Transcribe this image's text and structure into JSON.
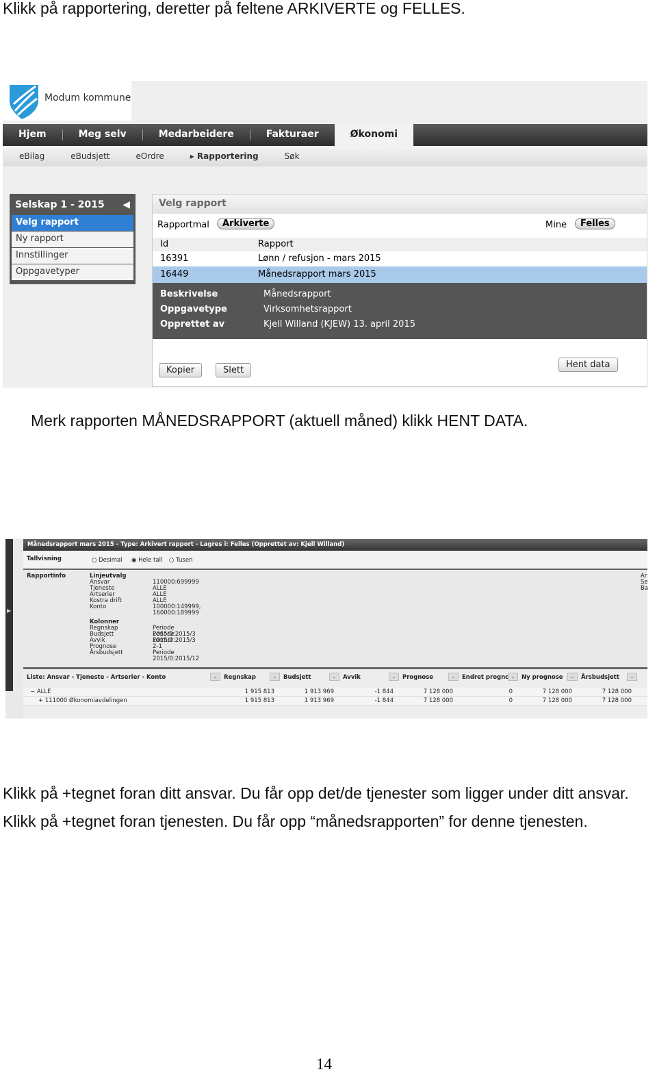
{
  "text": {
    "intro": "Klikk på rapportering, deretter på feltene ARKIVERTE og FELLES.",
    "step2": "Merk rapporten  MÅNEDSRAPPORT (aktuell måned) klikk HENT DATA.",
    "step3": "Klikk på +tegnet foran ditt ansvar. Du får opp det/de tjenester som ligger under ditt ansvar. Klikk på +tegnet foran tjenesten. Du får opp “månedsrapporten” for denne tjenesten.",
    "page_number": "14"
  },
  "shot1": {
    "logo_text": "Modum kommune",
    "brand_color": "#2a9ad8",
    "nav": [
      "Hjem",
      "Meg selv",
      "Medarbeidere",
      "Fakturaer",
      "Økonomi"
    ],
    "nav_active": "Økonomi",
    "subnav": [
      "eBilag",
      "eBudsjett",
      "eOrdre",
      "Rapportering",
      "Søk"
    ],
    "sidebar": {
      "title": "Selskap 1 - 2015",
      "items": [
        "Velg rapport",
        "Ny rapport",
        "Innstillinger",
        "Oppgavetyper"
      ]
    },
    "panel": {
      "title": "Velg rapport",
      "rapportmal_label": "Rapportmal",
      "rapportmal_value": "Arkiverte",
      "mine_label": "Mine",
      "mine_value": "Felles",
      "columns": [
        "Id",
        "Rapport"
      ],
      "rows": [
        [
          "16391",
          "Lønn / refusjon - mars 2015"
        ],
        [
          "16449",
          "Månedsrapport mars 2015"
        ]
      ],
      "details": [
        [
          "Beskrivelse",
          "Månedsrapport"
        ],
        [
          "Oppgavetype",
          "Virksomhetsrapport"
        ],
        [
          "Opprettet av",
          "Kjell Willand (KJEW) 13. april 2015"
        ]
      ],
      "buttons": {
        "kopier": "Kopier",
        "slett": "Slett",
        "hent": "Hent data"
      }
    }
  },
  "shot2": {
    "title": "Månedsrapport mars 2015 - Type: Arkivert rapport - Lagres i: Felles (Opprettet av: Kjell Willand)",
    "tallvisning": "Tallvisning",
    "radios": [
      "Desimal",
      "Hele tall",
      "Tusen"
    ],
    "radio_selected": "Hele tall",
    "rapportinfo": "Rapportinfo",
    "linjeutvalg": "Linjeutvalg",
    "lines": [
      [
        "Ansvar",
        "110000:699999"
      ],
      [
        "Tjeneste",
        "ALLE"
      ],
      [
        "Artserier",
        "ALLE"
      ],
      [
        "Kostra drift",
        "ALLE"
      ],
      [
        "Konto",
        "100000:149999, 160000:189999"
      ]
    ],
    "kolonner": "Kolonner",
    "cols": [
      [
        "Regnskap",
        "Periode 2015/0:2015/3"
      ],
      [
        "Budsjett",
        "Periode 2015/0:2015/3"
      ],
      [
        "Avvik",
        "Formel 2-1"
      ],
      [
        "Prognose",
        ""
      ],
      [
        "Årsbudsjett",
        "Periode 2015/0:2015/12"
      ]
    ],
    "right_cut": [
      "Ar",
      "Se",
      "Ba"
    ],
    "grid_headers": [
      "Liste: Ansvar - Tjeneste - Artserier - Konto",
      "Regnskap",
      "Budsjett",
      "Avvik",
      "Prognose",
      "Endret prognc",
      "Ny prognose",
      "Årsbudsjett"
    ],
    "grid_rows": [
      [
        "− ALLE",
        "1 915 813",
        "1 913 969",
        "-1 844",
        "7 128 000",
        "0",
        "7 128 000",
        "7 128 000"
      ],
      [
        "+ 111000 Økonomiavdelingen",
        "1 915 813",
        "1 913 969",
        "-1 844",
        "7 128 000",
        "0",
        "7 128 000",
        "7 128 000"
      ]
    ]
  }
}
